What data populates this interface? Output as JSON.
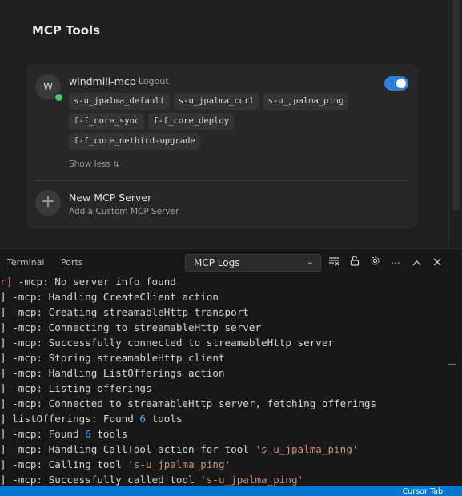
{
  "settings": {
    "title": "MCP Tools",
    "server": {
      "avatar_letter": "W",
      "name": "windmill-mcp",
      "logout_label": "Logout",
      "enabled": true,
      "tools": [
        "s-u_jpalma_default",
        "s-u_jpalma_curl",
        "s-u_jpalma_ping",
        "f-f_core_sync",
        "f-f_core_deploy",
        "f-f_core_netbird-upgrade"
      ],
      "show_less_label": "Show less",
      "show_less_icon": "chevron-up-down-icon"
    },
    "new_server": {
      "icon": "plus-icon",
      "title": "New MCP Server",
      "subtitle": "Add a Custom MCP Server"
    }
  },
  "panel": {
    "tabs": [
      "Terminal",
      "Ports"
    ],
    "output_selector": "MCP Logs",
    "controls": [
      "clear-output-icon",
      "lock-scroll-icon",
      "gear-icon",
      "more-icon",
      "maximize-panel-icon",
      "close-icon"
    ],
    "log_lines": [
      {
        "prefix": "r]",
        "error": true,
        "parts": [
          {
            "t": " -mcp: No server info found"
          }
        ]
      },
      {
        "prefix": "]",
        "parts": [
          {
            "t": " -mcp: Handling CreateClient action"
          }
        ]
      },
      {
        "prefix": "]",
        "parts": [
          {
            "t": " -mcp: Creating streamableHttp transport"
          }
        ]
      },
      {
        "prefix": "]",
        "parts": [
          {
            "t": " -mcp: Connecting to streamableHttp server"
          }
        ]
      },
      {
        "prefix": "]",
        "parts": [
          {
            "t": " -mcp: Successfully connected to streamableHttp server"
          }
        ]
      },
      {
        "prefix": "]",
        "parts": [
          {
            "t": " -mcp: Storing streamableHttp client"
          }
        ]
      },
      {
        "prefix": "]",
        "parts": [
          {
            "t": " -mcp: Handling ListOfferings action"
          }
        ]
      },
      {
        "prefix": "]",
        "parts": [
          {
            "t": " -mcp: Listing offerings"
          }
        ]
      },
      {
        "prefix": "]",
        "parts": [
          {
            "t": " -mcp: Connected to streamableHttp server, fetching offerings"
          }
        ]
      },
      {
        "prefix": "]",
        "parts": [
          {
            "t": " listOfferings: Found "
          },
          {
            "t": "6",
            "k": "num"
          },
          {
            "t": " tools"
          }
        ]
      },
      {
        "prefix": "]",
        "parts": [
          {
            "t": " -mcp: Found "
          },
          {
            "t": "6",
            "k": "num"
          },
          {
            "t": " tools"
          }
        ]
      },
      {
        "prefix": "]",
        "parts": [
          {
            "t": " -mcp: Handling CallTool action for tool "
          },
          {
            "t": "'s-u_jpalma_ping'",
            "k": "str"
          }
        ]
      },
      {
        "prefix": "]",
        "parts": [
          {
            "t": " -mcp: Calling tool "
          },
          {
            "t": "'s-u_jpalma_ping'",
            "k": "str"
          }
        ]
      },
      {
        "prefix": "]",
        "parts": [
          {
            "t": " -mcp: Successfully called tool "
          },
          {
            "t": "'s-u_jpalma_ping'",
            "k": "str"
          }
        ]
      }
    ]
  },
  "statusbar": {
    "item": "Cursor Tab"
  },
  "colors": {
    "accent": "#0078d4",
    "toggle_on": "#2f7fd6",
    "status_online": "#4ec46b",
    "string": "#ce9178",
    "number": "#4fa3ff",
    "error": "#e57373"
  }
}
